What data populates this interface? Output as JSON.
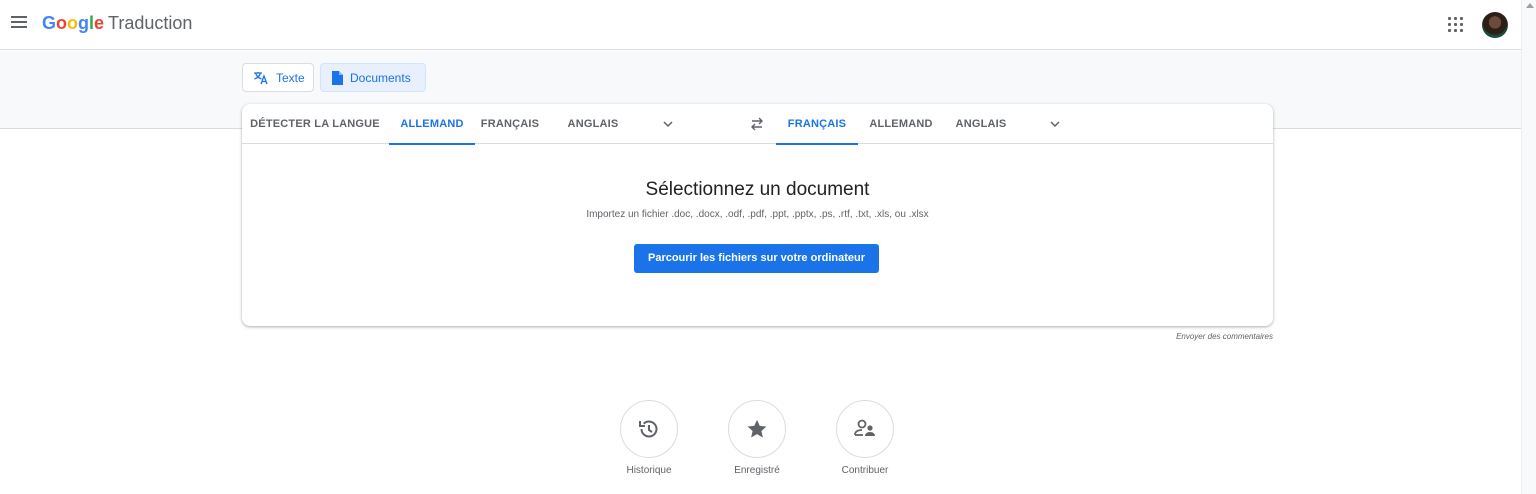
{
  "header": {
    "logo_letters": [
      "G",
      "o",
      "o",
      "g",
      "l",
      "e"
    ],
    "product_name": "Traduction"
  },
  "colors": {
    "accent": "#1a73e8",
    "google_blue": "#4285f4",
    "google_red": "#ea4335",
    "google_yellow": "#fbbc05",
    "google_green": "#34a853"
  },
  "modes": [
    {
      "label": "Texte",
      "icon": "translate-icon",
      "active": false
    },
    {
      "label": "Documents",
      "icon": "document-icon",
      "active": true
    }
  ],
  "source_langs": {
    "detect": "DÉTECTER LA LANGUE",
    "items": [
      "ALLEMAND",
      "FRANÇAIS",
      "ANGLAIS"
    ],
    "selected": "ALLEMAND"
  },
  "target_langs": {
    "items": [
      "FRANÇAIS",
      "ALLEMAND",
      "ANGLAIS"
    ],
    "selected": "FRANÇAIS"
  },
  "document_panel": {
    "title": "Sélectionnez un document",
    "subtitle": "Importez un fichier .doc, .docx, .odf, .pdf, .ppt, .pptx, .ps, .rtf, .txt, .xls, ou .xlsx",
    "browse_label": "Parcourir les fichiers sur votre ordinateur"
  },
  "feedback_link": "Envoyer des commentaires",
  "bottom_actions": [
    {
      "label": "Historique",
      "icon": "history-icon"
    },
    {
      "label": "Enregistré",
      "icon": "star-icon"
    },
    {
      "label": "Contribuer",
      "icon": "contribute-icon"
    }
  ]
}
